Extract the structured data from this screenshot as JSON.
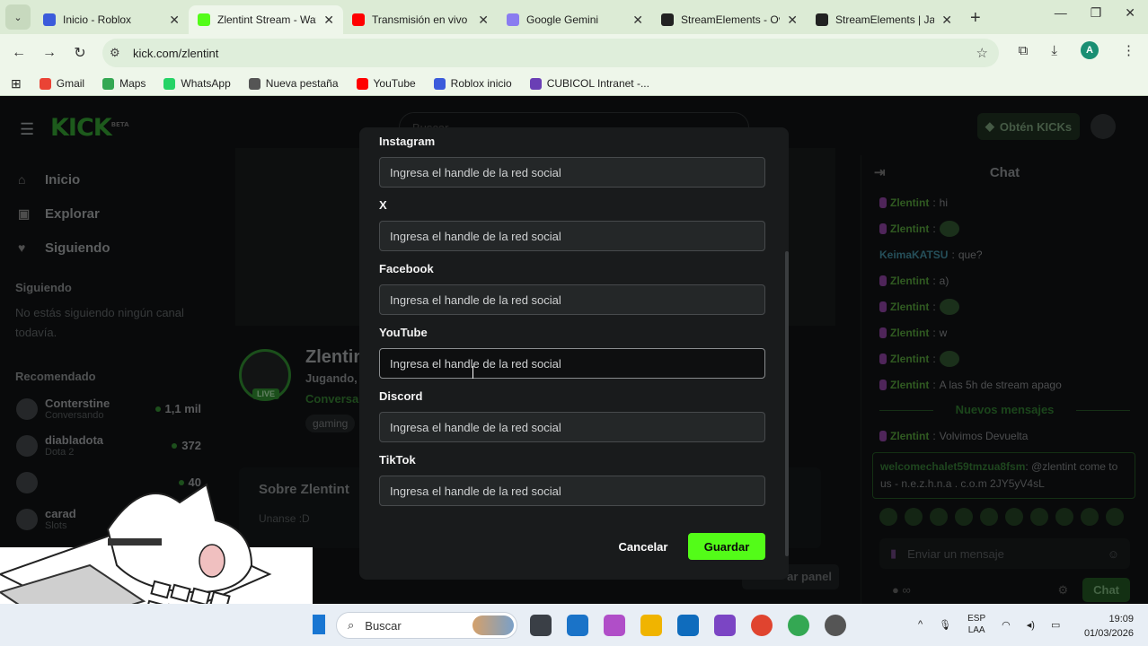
{
  "browser": {
    "tabs": [
      {
        "label": "Inicio - Roblox",
        "color": "#3b5bdb",
        "active": false
      },
      {
        "label": "Zlentint Stream - Wat",
        "color": "#53fc18",
        "active": true
      },
      {
        "label": "Transmisión en vivo -",
        "color": "#ff0000",
        "active": false
      },
      {
        "label": "Google Gemini",
        "color": "#8a7cf0",
        "active": false
      },
      {
        "label": "StreamElements - Ov",
        "color": "#222222",
        "active": false
      },
      {
        "label": "StreamElements | Jap",
        "color": "#222222",
        "active": false
      }
    ],
    "url": "kick.com/zlentint",
    "profile_initial": "A",
    "bookmarks": [
      {
        "label": "Gmail",
        "color": "#ea4335"
      },
      {
        "label": "Maps",
        "color": "#34a853"
      },
      {
        "label": "WhatsApp",
        "color": "#25d366"
      },
      {
        "label": "Nueva pestaña",
        "color": "#555555"
      },
      {
        "label": "YouTube",
        "color": "#ff0000"
      },
      {
        "label": "Roblox inicio",
        "color": "#3b5bdb"
      },
      {
        "label": "CUBICOL Intranet -...",
        "color": "#6a3fb5"
      }
    ]
  },
  "kick": {
    "logo": "KICK",
    "logo_beta": "BETA",
    "search_placeholder": "Buscar",
    "get_kicks": "Obtén KICKs",
    "nav": [
      {
        "label": "Inicio",
        "icon": "home-icon",
        "glyph": "⌂"
      },
      {
        "label": "Explorar",
        "icon": "explore-icon",
        "glyph": "▣"
      },
      {
        "label": "Siguiendo",
        "icon": "heart-icon",
        "glyph": "♥"
      }
    ],
    "following_title": "Siguiendo",
    "following_empty": "No estás siguiendo ningún canal todavía.",
    "recommended_title": "Recomendado",
    "recommended": [
      {
        "name": "Conterstine",
        "sub": "Conversando",
        "count": "1,1 mil"
      },
      {
        "name": "diabladota",
        "sub": "Dota 2",
        "count": "372"
      },
      {
        "name": "",
        "sub": "",
        "count": "40"
      },
      {
        "name": "carad",
        "sub": "Slots",
        "count": ""
      }
    ],
    "channel_name": "Zlentint",
    "channel_activity": "Jugando,",
    "channel_category": "Conversa",
    "live_badge": "LIVE",
    "tag": "gaming",
    "about_title": "Sobre Zlentint",
    "about_desc": "Unanse :D",
    "edit_panel": "ar panel"
  },
  "chat": {
    "title": "Chat",
    "messages": [
      {
        "user": "Zlentint",
        "text": "hi",
        "emote": false
      },
      {
        "user": "Zlentint",
        "text": "",
        "emote": true
      },
      {
        "user": "KeimaKATSU",
        "text": "que?",
        "emote": false
      },
      {
        "user": "Zlentint",
        "text": "a)",
        "emote": false
      },
      {
        "user": "Zlentint",
        "text": "",
        "emote": true
      },
      {
        "user": "Zlentint",
        "text": "w",
        "emote": false
      },
      {
        "user": "Zlentint",
        "text": "",
        "emote": true
      },
      {
        "user": "Zlentint",
        "text": "A las 5h de stream apago",
        "emote": false
      }
    ],
    "new_messages": "Nuevos mensajes",
    "after_new": {
      "user": "Zlentint",
      "text": "Volvimos Devuelta"
    },
    "highlight": {
      "user": "welcomechalet59tmzua8fsm",
      "text": "@zlentint come to us - n.e.z.h.n.a . c.o.m 2JY5yV4sL"
    },
    "input_placeholder": "Enviar un mensaje",
    "count_symbol": "∞",
    "send_label": "Chat"
  },
  "modal": {
    "fields": [
      {
        "label": "Instagram",
        "placeholder": "Ingresa el handle de la red social"
      },
      {
        "label": "X",
        "placeholder": "Ingresa el handle de la red social"
      },
      {
        "label": "Facebook",
        "placeholder": "Ingresa el handle de la red social"
      },
      {
        "label": "YouTube",
        "placeholder": "Ingresa el handle de la red social"
      },
      {
        "label": "Discord",
        "placeholder": "Ingresa el handle de la red social"
      },
      {
        "label": "TikTok",
        "placeholder": "Ingresa el handle de la red social"
      }
    ],
    "cancel_label": "Cancelar",
    "save_label": "Guardar",
    "accent": "#53fc18"
  },
  "taskbar": {
    "search_placeholder": "Buscar",
    "lang_top": "ESP",
    "lang_bottom": "LAA",
    "time": "19:09",
    "date": "01/03/2026"
  }
}
